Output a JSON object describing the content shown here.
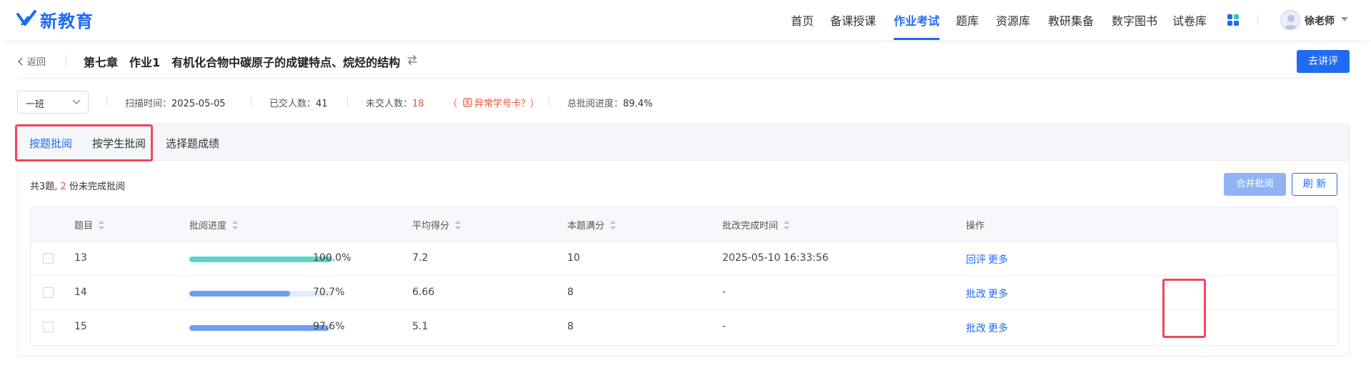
{
  "colors": {
    "primary": "#1f6bf2",
    "danger": "#e5533b",
    "bar_complete": "#5bd6c9",
    "bar_partial": "#6e9ef1",
    "highlight": "#f0475d"
  },
  "brand": {
    "name": "新教育"
  },
  "nav": {
    "items": [
      "首页",
      "备课授课",
      "作业考试",
      "题库",
      "资源库",
      "教研集备",
      "数字图书",
      "试卷库"
    ],
    "active": "作业考试",
    "apps_icon": "grid-apps-icon",
    "user_name": "徐老师"
  },
  "header": {
    "back_label": "返回",
    "title": "第七章　作业1　有机化合物中碳原子的成键特点、烷烃的结构",
    "review_button": "去讲评"
  },
  "filters": {
    "class_value": "一班",
    "scan_time_label": "扫描时间：",
    "scan_time_value": "2025-05-05",
    "submitted_label": "已交人数：",
    "submitted_value": "41",
    "unsubmitted_label": "未交人数：",
    "unsubmitted_value": "18",
    "abnormal_text": "异常学号卡？）",
    "abnormal_prefix": "（",
    "progress_label": "总批阅进度：",
    "progress_value": "89.4%"
  },
  "tabs": [
    {
      "label": "按题批阅",
      "active": true
    },
    {
      "label": "按学生批阅",
      "active": false
    },
    {
      "label": "选择题成绩",
      "active": false
    }
  ],
  "summary": {
    "prefix": "共3题, ",
    "count": "2",
    "suffix": " 份未完成批阅"
  },
  "toolbar": {
    "merge_label": "合并批阅",
    "refresh_label": "刷 新"
  },
  "table": {
    "headers": [
      "题目",
      "批阅进度",
      "平均得分",
      "本题满分",
      "批改完成时间",
      "操作"
    ],
    "rows": [
      {
        "question": "13",
        "progress": 100.0,
        "progress_text": "100.0%",
        "avg": "7.2",
        "full": "10",
        "time": "2025-05-10 16:33:56",
        "action": "回评",
        "more": "更多"
      },
      {
        "question": "14",
        "progress": 70.7,
        "progress_text": "70.7%",
        "avg": "6.66",
        "full": "8",
        "time": "-",
        "action": "批改",
        "more": "更多"
      },
      {
        "question": "15",
        "progress": 97.6,
        "progress_text": "97.6%",
        "avg": "5.1",
        "full": "8",
        "time": "-",
        "action": "批改",
        "more": "更多"
      }
    ]
  }
}
